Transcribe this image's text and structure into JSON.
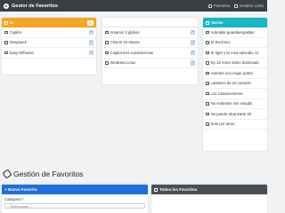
{
  "navbar": {
    "brand": "Gestor de Favoritos",
    "links": [
      {
        "label": "Favoritos"
      },
      {
        "label": "Gestión Links"
      }
    ]
  },
  "columns": {
    "left": {
      "header": "Ia",
      "badge": "6",
      "items": [
        "Copilot",
        "Deepseek",
        "Easy Diffusion"
      ]
    },
    "middle": {
      "header": "",
      "items": [
        "Amarrar 3 globos",
        "Chanin Vs Neuse",
        "Copilot test consistencias",
        "Windows Linux"
      ]
    },
    "right": {
      "header": "Series",
      "items": [
        "Adorable guardaespaldas",
        "El Rechazo",
        "El tigre y la rosa episodio 12",
        "Ep 12 Amor doleo dominado",
        "Hombre rico mujer pobre",
        "Lastaces de mi corazón",
        "Los Casamenteros",
        "No molestes mis estudio",
        "No puedo alcanzarte 20",
        "Solo por amor"
      ]
    }
  },
  "page": {
    "title": "Gestión de Favoritos"
  },
  "new_favorite": {
    "header": "+ Nuevo Favorito",
    "category_label": "Categoría *",
    "category_value": "-- Selecciona --"
  },
  "all_favorites": {
    "header": "Todos los Favoritos"
  },
  "colors": {
    "navbar": "#3a3f45",
    "ia_header": "#f5a623",
    "series_header": "#18b5c2",
    "new_header": "#1f6fe0",
    "all_header": "#4a4f56"
  }
}
